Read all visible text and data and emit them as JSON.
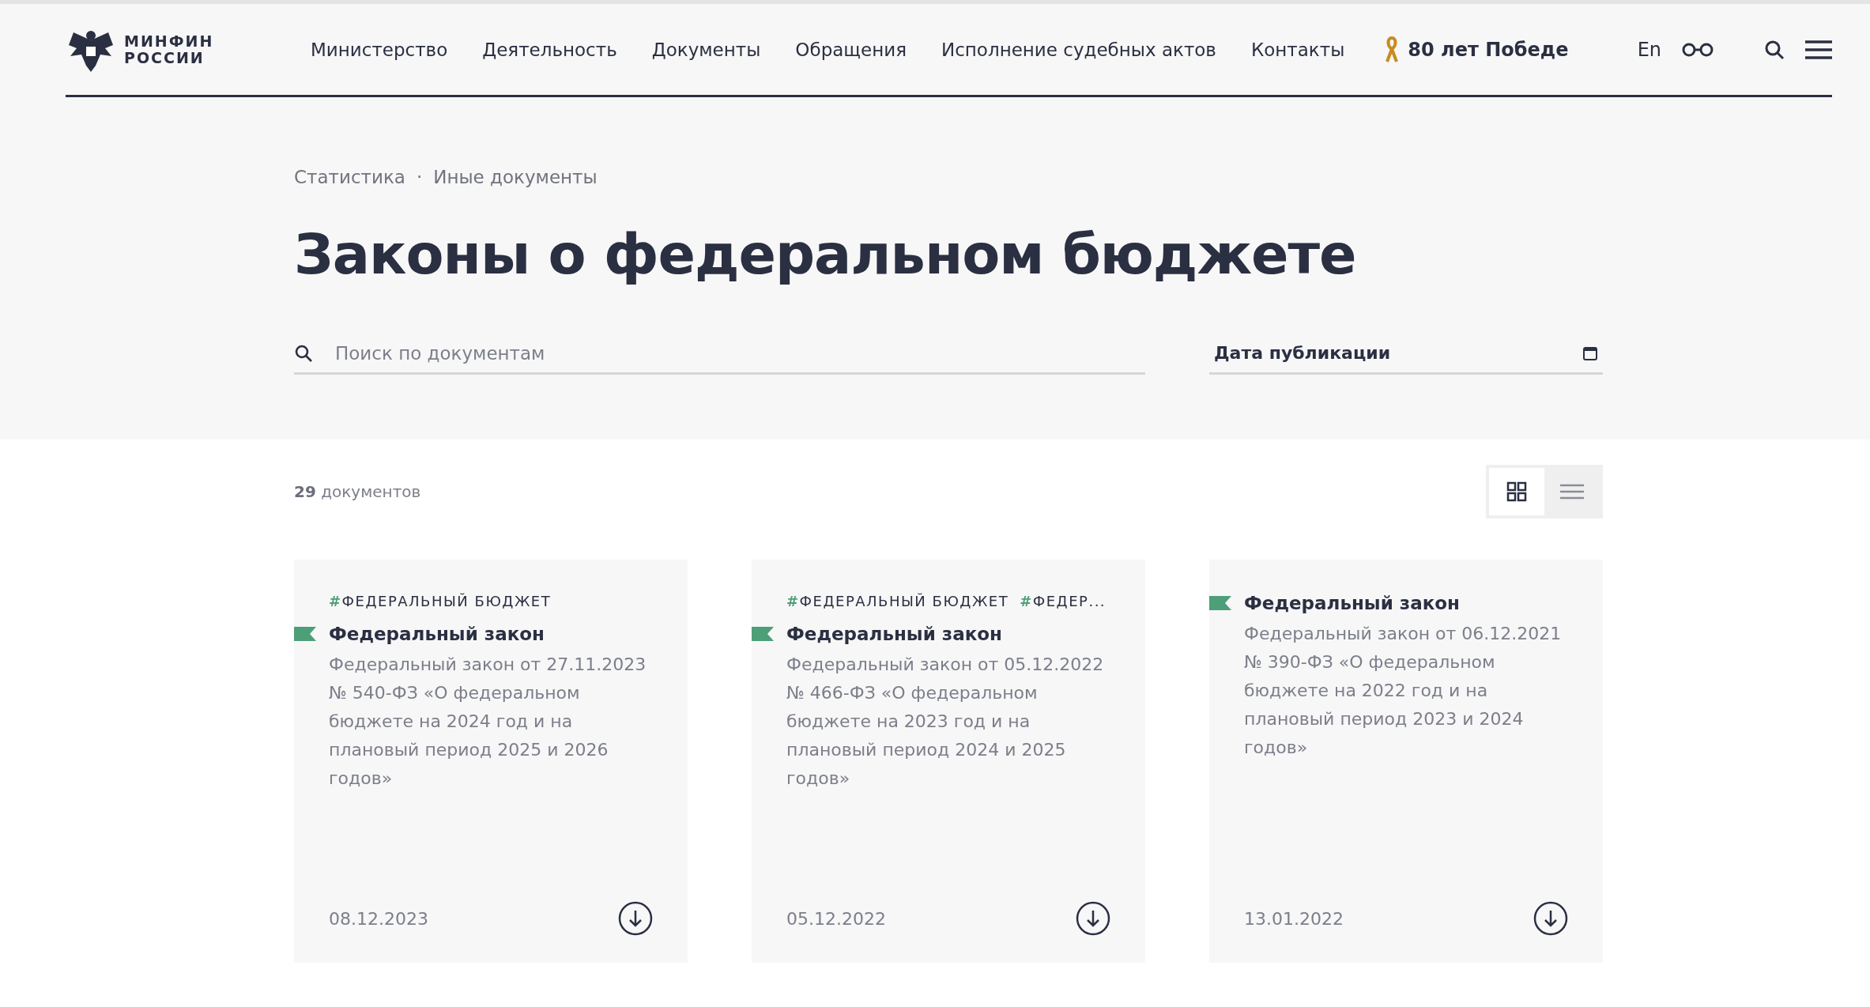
{
  "header": {
    "logo_text": [
      "МИНФИН",
      "РОССИИ"
    ],
    "nav": [
      {
        "label": "Министерство"
      },
      {
        "label": "Деятельность"
      },
      {
        "label": "Документы"
      },
      {
        "label": "Обращения"
      },
      {
        "label": "Исполнение судебных актов"
      },
      {
        "label": "Контакты"
      }
    ],
    "victory_link": "80 лет Победе",
    "lang": "En"
  },
  "breadcrumbs": [
    "Статистика",
    "·",
    "Иные документы"
  ],
  "title": "Законы о федеральном бюджете",
  "search": {
    "placeholder": "Поиск по документам"
  },
  "date_filter": {
    "label": "Дата публикации"
  },
  "count": {
    "number": "29",
    "text": "документов"
  },
  "views": [
    {
      "kind": "grid",
      "selected": true
    },
    {
      "kind": "list",
      "selected": false
    }
  ],
  "cards": [
    {
      "tags": [
        {
          "hash": "#",
          "label": "ФЕДЕРАЛЬНЫЙ БЮДЖЕТ"
        }
      ],
      "type": "Федеральный закон",
      "description": "Федеральный закон от 27.11.2023 № 540-ФЗ «О федеральном бюджете на 2024 год и на плановый период 2025 и 2026 годов»",
      "date": "08.12.2023",
      "color": "#4c9f78"
    },
    {
      "tags": [
        {
          "hash": "#",
          "label": "ФЕДЕРАЛЬНЫЙ БЮДЖЕТ"
        },
        {
          "hash": "#",
          "label": "ФЕДЕР..."
        }
      ],
      "type": "Федеральный закон",
      "description": "Федеральный закон от 05.12.2022 № 466-ФЗ «О федеральном бюджете на 2023 год и на плановый период 2024 и 2025 годов»",
      "date": "05.12.2022",
      "color": "#4c9f78"
    },
    {
      "type": "Федеральный закон",
      "description": "Федеральный закон от 06.12.2021 № 390-ФЗ «О федеральном бюджете на 2022 год и на плановый период 2023 и 2024 годов»",
      "date": "13.01.2022",
      "color": "#4c9f78"
    }
  ]
}
